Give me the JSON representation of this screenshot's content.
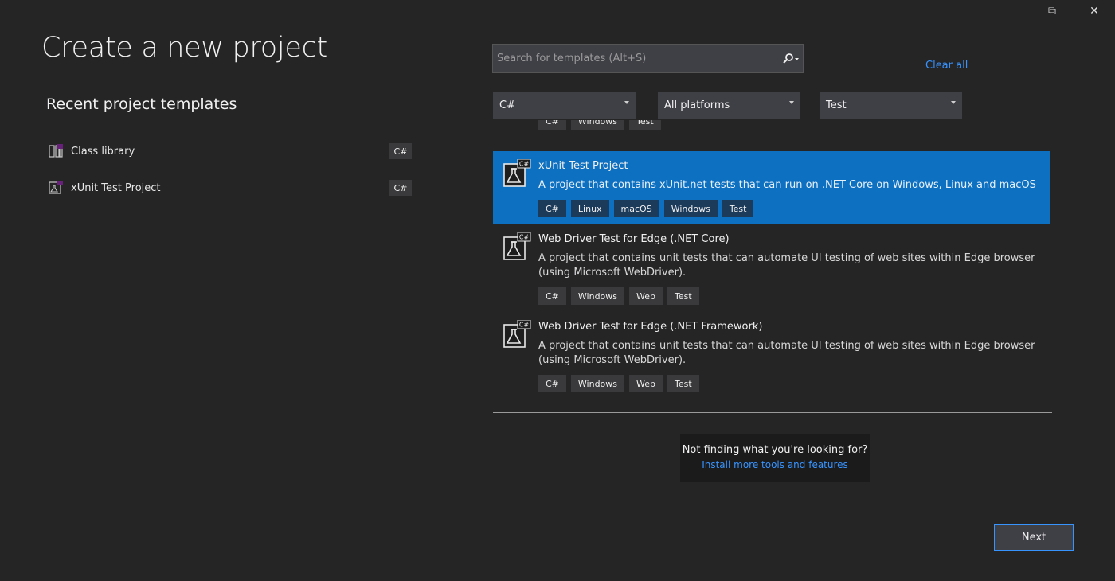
{
  "window": {
    "restore_icon": "restore-icon",
    "close_icon": "close-icon",
    "close_glyph": "✕",
    "restore_glyph": "⧉"
  },
  "page_title": "Create a new project",
  "recent": {
    "title": "Recent project templates",
    "items": [
      {
        "label": "Class library",
        "tag": "C#",
        "icon": "class-library-icon"
      },
      {
        "label": "xUnit Test Project",
        "tag": "C#",
        "icon": "test-project-icon"
      }
    ]
  },
  "search": {
    "placeholder": "Search for templates (Alt+S)",
    "value": "",
    "icon": "search-icon"
  },
  "clear_all": "Clear all",
  "filters": {
    "language": "C#",
    "platform": "All platforms",
    "project_type": "Test"
  },
  "templates": [
    {
      "name": "",
      "description": "",
      "tags": [
        "C#",
        "Windows",
        "Test"
      ],
      "partial": true
    },
    {
      "name": "xUnit Test Project",
      "description": "A project that contains xUnit.net tests that can run on .NET Core on Windows, Linux and macOS",
      "tags": [
        "C#",
        "Linux",
        "macOS",
        "Windows",
        "Test"
      ],
      "selected": true
    },
    {
      "name": "Web Driver Test for Edge (.NET Core)",
      "description": "A project that contains unit tests that can automate UI testing of web sites within Edge browser (using Microsoft WebDriver).",
      "tags": [
        "C#",
        "Windows",
        "Web",
        "Test"
      ]
    },
    {
      "name": "Web Driver Test for Edge (.NET Framework)",
      "description": "A project that contains unit tests that can automate UI testing of web sites within Edge browser (using Microsoft WebDriver).",
      "tags": [
        "C#",
        "Windows",
        "Web",
        "Test"
      ]
    }
  ],
  "help": {
    "question": "Not finding what you're looking for?",
    "link": "Install more tools and features"
  },
  "next_button": "Next",
  "colors": {
    "background": "#252526",
    "accent": "#0e70c0",
    "link": "#3794ff",
    "control": "#3f3f46"
  }
}
